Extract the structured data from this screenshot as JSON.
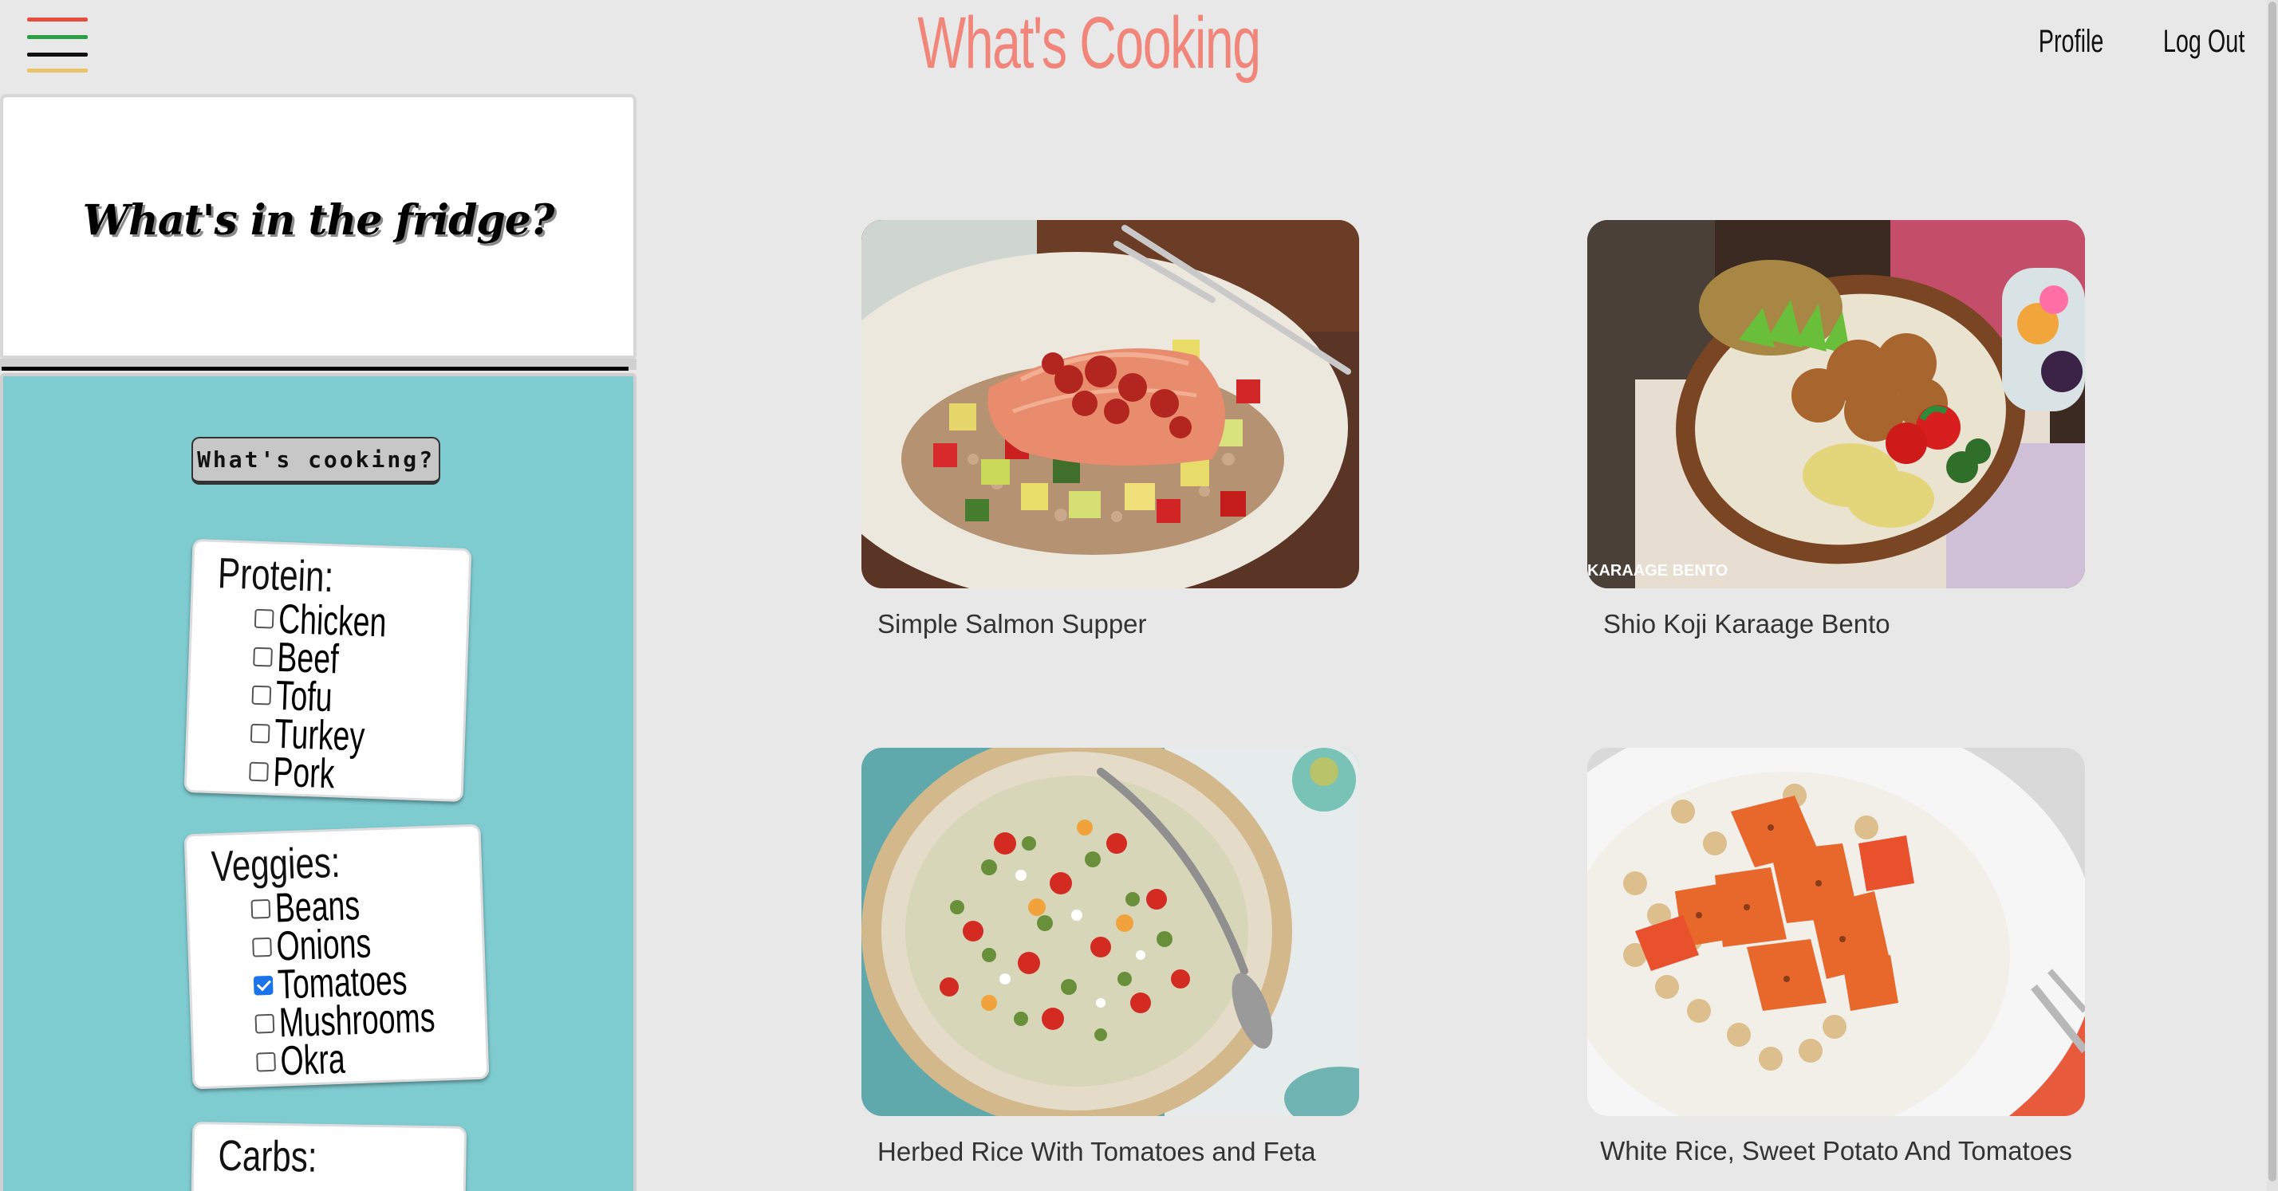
{
  "header": {
    "title": "What's Cooking",
    "menu_icon": "hamburger-menu-icon",
    "menu_colors": [
      "#e84c3d",
      "#2e9e44",
      "#111111",
      "#e9c46a"
    ],
    "title_color": "#f1857a",
    "nav": [
      {
        "label": "Profile"
      },
      {
        "label": "Log Out"
      }
    ]
  },
  "sidebar": {
    "heading": "What's in the fridge?",
    "cook_button": "What's cooking?",
    "panel_color": "#7ecbd0",
    "groups": [
      {
        "title": "Protein:",
        "options": [
          {
            "label": "Chicken",
            "checked": false
          },
          {
            "label": "Beef",
            "checked": false
          },
          {
            "label": "Tofu",
            "checked": false
          },
          {
            "label": "Turkey",
            "checked": false
          },
          {
            "label": "Pork",
            "checked": false
          }
        ]
      },
      {
        "title": "Veggies:",
        "options": [
          {
            "label": "Beans",
            "checked": false
          },
          {
            "label": "Onions",
            "checked": false
          },
          {
            "label": "Tomatoes",
            "checked": true
          },
          {
            "label": "Mushrooms",
            "checked": false
          },
          {
            "label": "Okra",
            "checked": false
          }
        ]
      },
      {
        "title": "Carbs:",
        "options": []
      }
    ]
  },
  "recipes": [
    {
      "name": "Simple Salmon Supper"
    },
    {
      "name": "Shio Koji Karaage Bento",
      "photo_caption": "KARAAGE BENTO"
    },
    {
      "name": "Herbed Rice With Tomatoes and Feta"
    },
    {
      "name": "White Rice, Sweet Potato And Tomatoes"
    }
  ]
}
